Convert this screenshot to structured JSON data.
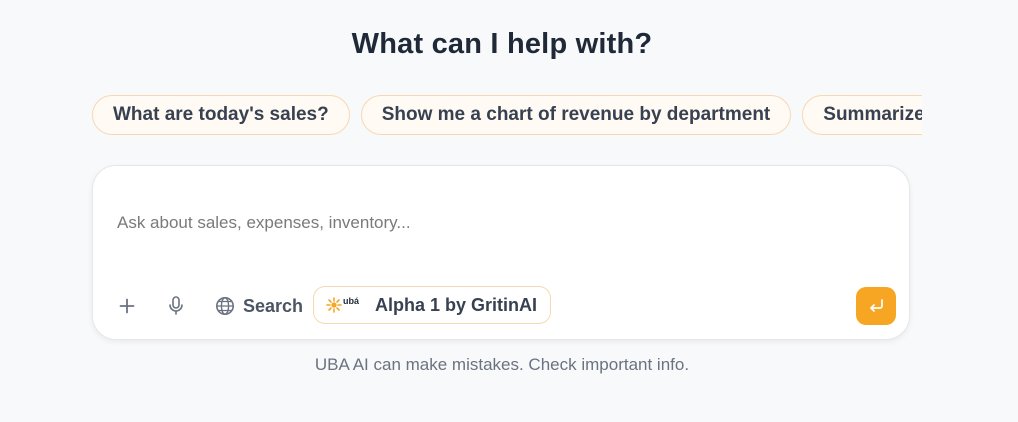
{
  "heading": "What can I help with?",
  "suggestions": [
    "What are today's sales?",
    "Show me a chart of revenue by department",
    "Summarize"
  ],
  "composer": {
    "placeholder": "Ask about sales, expenses, inventory...",
    "value": "",
    "add_icon": "plus-icon",
    "mic_icon": "microphone-icon",
    "search_icon": "globe-icon",
    "search_label": "Search",
    "model": {
      "logo_text": "ubá",
      "label": "Alpha 1 by GritinAI"
    },
    "send_icon": "enter-icon"
  },
  "disclaimer": "UBA AI can make mistakes. Check important info.",
  "colors": {
    "accent": "#f6a623",
    "chip_border": "#f5d9b4",
    "background": "#f8f9fa"
  }
}
